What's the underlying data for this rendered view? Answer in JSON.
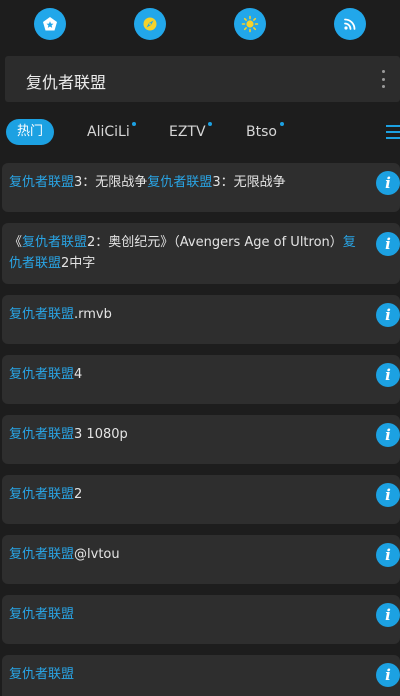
{
  "toolbar": {
    "buttons": [
      {
        "icon": "pentagon-star-icon"
      },
      {
        "icon": "compass-icon"
      },
      {
        "icon": "sun-icon"
      },
      {
        "icon": "rss-icon"
      }
    ]
  },
  "search": {
    "query": "复仇者联盟"
  },
  "tabs": [
    {
      "label": "热门",
      "active": true,
      "dot": false
    },
    {
      "label": "AliCiLi",
      "active": false,
      "dot": true
    },
    {
      "label": "EZTV",
      "active": false,
      "dot": true
    },
    {
      "label": "Btso",
      "active": false,
      "dot": true
    }
  ],
  "results": [
    {
      "segments": [
        {
          "t": "复仇者联盟",
          "hl": true
        },
        {
          "t": "3：无限战争",
          "hl": false
        },
        {
          "t": "复仇者联盟",
          "hl": true
        },
        {
          "t": "3：无限战争",
          "hl": false
        }
      ]
    },
    {
      "segments": [
        {
          "t": "《",
          "hl": false
        },
        {
          "t": "复仇者联盟",
          "hl": true
        },
        {
          "t": "2：奥创纪元》（Avengers Age of Ultron）",
          "hl": false
        },
        {
          "t": "复仇者联盟",
          "hl": true
        },
        {
          "t": "2中字",
          "hl": false
        }
      ]
    },
    {
      "segments": [
        {
          "t": "复仇者联盟",
          "hl": true
        },
        {
          "t": ".rmvb",
          "hl": false
        }
      ]
    },
    {
      "segments": [
        {
          "t": "复仇者联盟",
          "hl": true
        },
        {
          "t": "4",
          "hl": false
        }
      ]
    },
    {
      "segments": [
        {
          "t": "复仇者联盟",
          "hl": true
        },
        {
          "t": "3 1080p",
          "hl": false
        }
      ]
    },
    {
      "segments": [
        {
          "t": "复仇者联盟",
          "hl": true
        },
        {
          "t": "2",
          "hl": false
        }
      ]
    },
    {
      "segments": [
        {
          "t": "复仇者联盟",
          "hl": true
        },
        {
          "t": "@lvtou",
          "hl": false
        }
      ]
    },
    {
      "segments": [
        {
          "t": "复仇者联盟",
          "hl": true
        }
      ]
    },
    {
      "segments": [
        {
          "t": "复仇者联盟",
          "hl": true
        }
      ]
    }
  ],
  "info_glyph": "i",
  "colors": {
    "accent": "#1ca1e2",
    "background": "#1d1d1d",
    "card": "#2e2e2e"
  }
}
